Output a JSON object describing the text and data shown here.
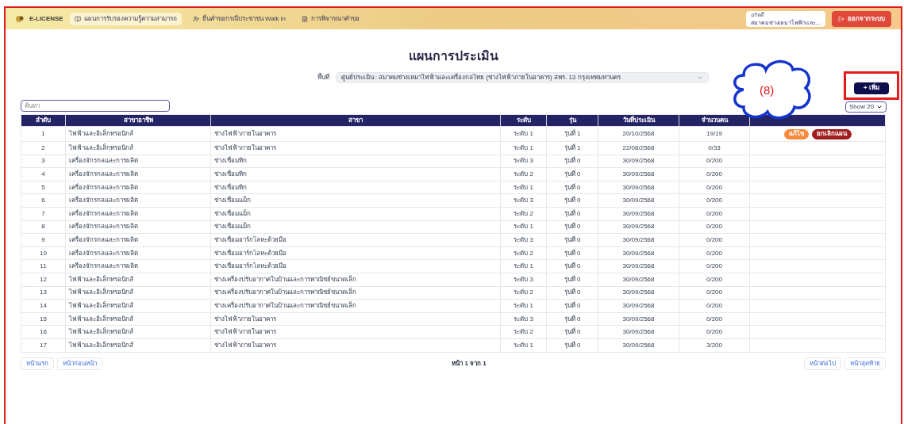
{
  "header": {
    "brand": "E-LICENSE",
    "nav": [
      {
        "label": "แผนการรับรองความรู้ความสามารถ",
        "selected": true
      },
      {
        "label": "ยื่นคำขอกรณีประชาชน Walk in",
        "selected": false
      },
      {
        "label": "การพิจารณาคำขอ",
        "selected": false
      }
    ],
    "user": {
      "name": "อรัลดี",
      "org": "สมาคมช่างเหมาไฟฟ้าและ..."
    },
    "logout": "ออกจากระบบ"
  },
  "title": "แผนการประเมิน",
  "filter": {
    "label": "พื้นที่",
    "value": "ศูนย์ประเมิน : สมาคมช่างเหมาไฟฟ้าและเครื่องกลไทย (ช่างไฟฟ้าภายในอาคาร) สพร. 13 กรุงเทพมหานคร"
  },
  "annotation": {
    "callout": "(8)"
  },
  "add_button": "+ เพิ่ม",
  "search": {
    "placeholder": "ค้นหา"
  },
  "page_size": "Show 20",
  "table": {
    "columns": [
      "ลำดับ",
      "สาขาอาชีพ",
      "สาขา",
      "ระดับ",
      "รุ่น",
      "วันที่ประเมิน",
      "จำนวนคน"
    ],
    "rows": [
      {
        "cells": [
          "1",
          "ไฟฟ้าและอิเล็กทรอนิกส์",
          "ช่างไฟฟ้าภายในอาคาร",
          "ระดับ 1",
          "รุ่นที่ 1",
          "20/10/2568",
          "19/19"
        ],
        "actions": [
          {
            "kind": "edit",
            "label": "แก้ไข"
          },
          {
            "kind": "cancel",
            "label": "ยกเลิกแผน"
          }
        ]
      },
      {
        "cells": [
          "2",
          "ไฟฟ้าและอิเล็กทรอนิกส์",
          "ช่างไฟฟ้าภายในอาคาร",
          "ระดับ 1",
          "รุ่นที่ 1",
          "22/08/2568",
          "0/33"
        ]
      },
      {
        "cells": [
          "3",
          "เครื่องจักรกลและการผลิต",
          "ช่างเชื่อมทิก",
          "ระดับ 3",
          "รุ่นที่ 0",
          "30/09/2568",
          "0/200"
        ]
      },
      {
        "cells": [
          "4",
          "เครื่องจักรกลและการผลิต",
          "ช่างเชื่อมทิก",
          "ระดับ 2",
          "รุ่นที่ 0",
          "30/09/2568",
          "0/200"
        ]
      },
      {
        "cells": [
          "5",
          "เครื่องจักรกลและการผลิต",
          "ช่างเชื่อมทิก",
          "ระดับ 1",
          "รุ่นที่ 0",
          "30/09/2568",
          "0/200"
        ]
      },
      {
        "cells": [
          "6",
          "เครื่องจักรกลและการผลิต",
          "ช่างเชื่อมแม็ก",
          "ระดับ 3",
          "รุ่นที่ 0",
          "30/09/2568",
          "0/200"
        ]
      },
      {
        "cells": [
          "7",
          "เครื่องจักรกลและการผลิต",
          "ช่างเชื่อมแม็ก",
          "ระดับ 2",
          "รุ่นที่ 0",
          "30/09/2568",
          "0/200"
        ]
      },
      {
        "cells": [
          "8",
          "เครื่องจักรกลและการผลิต",
          "ช่างเชื่อมแม็ก",
          "ระดับ 1",
          "รุ่นที่ 0",
          "30/09/2568",
          "0/200"
        ]
      },
      {
        "cells": [
          "9",
          "เครื่องจักรกลและการผลิต",
          "ช่างเชื่อมอาร์กโลหะด้วยมือ",
          "ระดับ 3",
          "รุ่นที่ 0",
          "30/09/2568",
          "0/200"
        ]
      },
      {
        "cells": [
          "10",
          "เครื่องจักรกลและการผลิต",
          "ช่างเชื่อมอาร์กโลหะด้วยมือ",
          "ระดับ 2",
          "รุ่นที่ 0",
          "30/09/2568",
          "0/200"
        ]
      },
      {
        "cells": [
          "11",
          "เครื่องจักรกลและการผลิต",
          "ช่างเชื่อมอาร์กโลหะด้วยมือ",
          "ระดับ 1",
          "รุ่นที่ 0",
          "30/09/2568",
          "0/200"
        ]
      },
      {
        "cells": [
          "12",
          "ไฟฟ้าและอิเล็กทรอนิกส์",
          "ช่างเครื่องปรับอากาศในบ้านและการพาณิชย์ขนาดเล็ก",
          "ระดับ 3",
          "รุ่นที่ 0",
          "30/09/2568",
          "0/200"
        ]
      },
      {
        "cells": [
          "13",
          "ไฟฟ้าและอิเล็กทรอนิกส์",
          "ช่างเครื่องปรับอากาศในบ้านและการพาณิชย์ขนาดเล็ก",
          "ระดับ 2",
          "รุ่นที่ 0",
          "30/09/2568",
          "0/200"
        ]
      },
      {
        "cells": [
          "14",
          "ไฟฟ้าและอิเล็กทรอนิกส์",
          "ช่างเครื่องปรับอากาศในบ้านและการพาณิชย์ขนาดเล็ก",
          "ระดับ 1",
          "รุ่นที่ 0",
          "30/09/2568",
          "0/200"
        ]
      },
      {
        "cells": [
          "15",
          "ไฟฟ้าและอิเล็กทรอนิกส์",
          "ช่างไฟฟ้าภายในอาคาร",
          "ระดับ 3",
          "รุ่นที่ 0",
          "30/09/2568",
          "0/200"
        ]
      },
      {
        "cells": [
          "16",
          "ไฟฟ้าและอิเล็กทรอนิกส์",
          "ช่างไฟฟ้าภายในอาคาร",
          "ระดับ 2",
          "รุ่นที่ 0",
          "30/09/2568",
          "0/200"
        ]
      },
      {
        "cells": [
          "17",
          "ไฟฟ้าและอิเล็กทรอนิกส์",
          "ช่างไฟฟ้าภายในอาคาร",
          "ระดับ 1",
          "รุ่นที่ 0",
          "30/09/2568",
          "3/200"
        ]
      }
    ]
  },
  "pagination": {
    "first": "หน้าแรก",
    "prev": "หน้าก่อนหน้า",
    "info": "หน้า 1 จาก 1",
    "next": "หน้าต่อไป",
    "last": "หน้าสุดท้าย"
  }
}
